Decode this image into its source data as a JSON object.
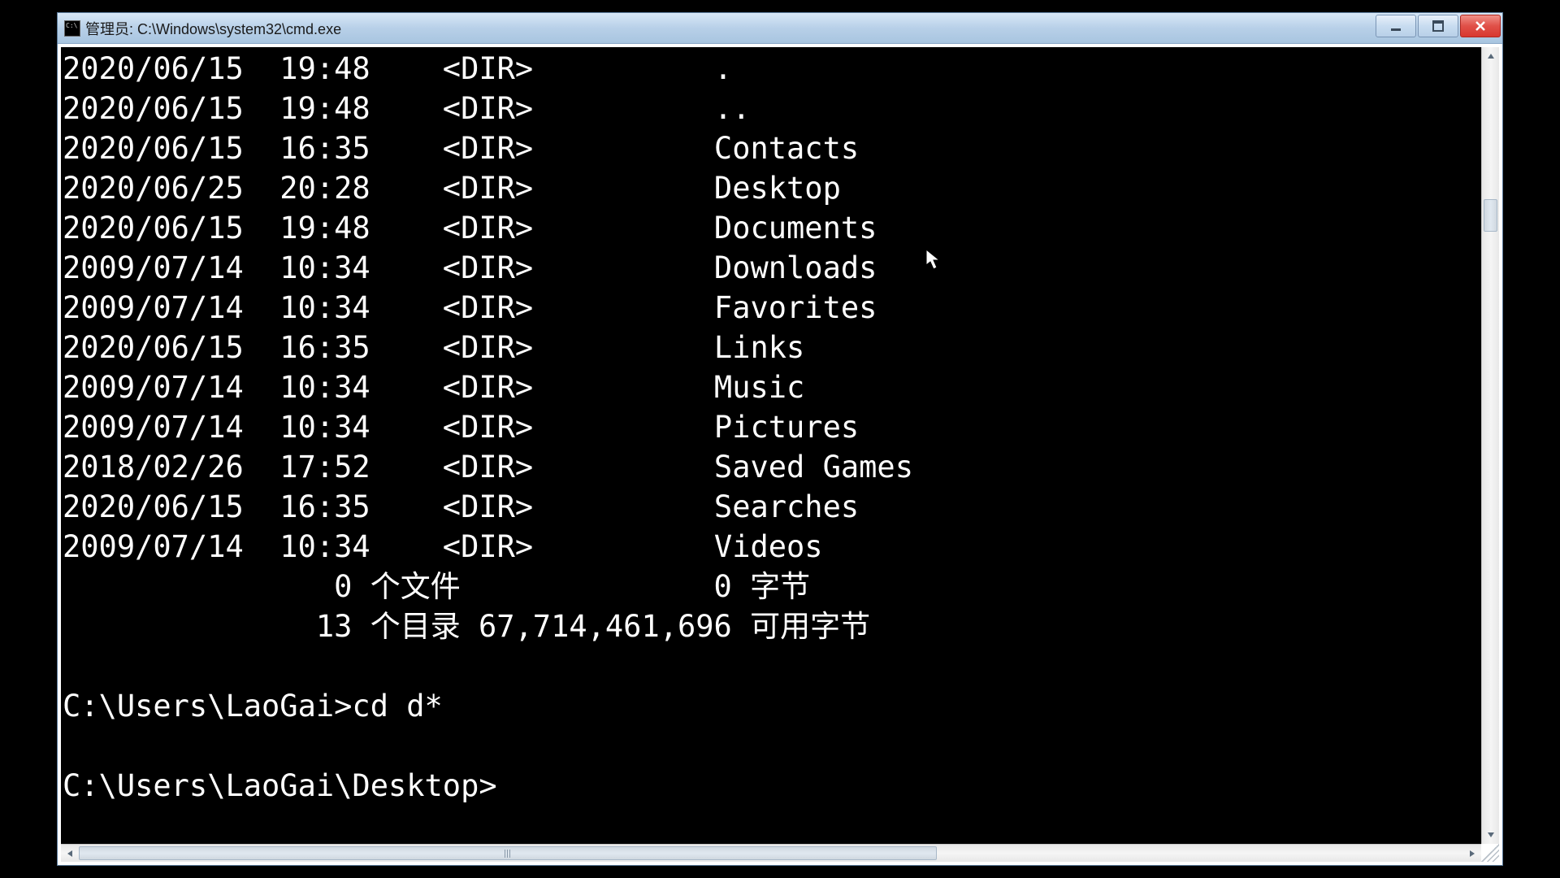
{
  "window": {
    "title": "管理员: C:\\Windows\\system32\\cmd.exe"
  },
  "dir_listing": [
    {
      "date": "2020/06/15",
      "time": "19:48",
      "type": "<DIR>",
      "name": "."
    },
    {
      "date": "2020/06/15",
      "time": "19:48",
      "type": "<DIR>",
      "name": ".."
    },
    {
      "date": "2020/06/15",
      "time": "16:35",
      "type": "<DIR>",
      "name": "Contacts"
    },
    {
      "date": "2020/06/25",
      "time": "20:28",
      "type": "<DIR>",
      "name": "Desktop"
    },
    {
      "date": "2020/06/15",
      "time": "19:48",
      "type": "<DIR>",
      "name": "Documents"
    },
    {
      "date": "2009/07/14",
      "time": "10:34",
      "type": "<DIR>",
      "name": "Downloads"
    },
    {
      "date": "2009/07/14",
      "time": "10:34",
      "type": "<DIR>",
      "name": "Favorites"
    },
    {
      "date": "2020/06/15",
      "time": "16:35",
      "type": "<DIR>",
      "name": "Links"
    },
    {
      "date": "2009/07/14",
      "time": "10:34",
      "type": "<DIR>",
      "name": "Music"
    },
    {
      "date": "2009/07/14",
      "time": "10:34",
      "type": "<DIR>",
      "name": "Pictures"
    },
    {
      "date": "2018/02/26",
      "time": "17:52",
      "type": "<DIR>",
      "name": "Saved Games"
    },
    {
      "date": "2020/06/15",
      "time": "16:35",
      "type": "<DIR>",
      "name": "Searches"
    },
    {
      "date": "2009/07/14",
      "time": "10:34",
      "type": "<DIR>",
      "name": "Videos"
    }
  ],
  "summary": {
    "files_line": "               0 个文件              0 字节",
    "dirs_line": "              13 个目录 67,714,461,696 可用字节"
  },
  "prompts": {
    "cmd1_prompt": "C:\\Users\\LaoGai>",
    "cmd1_input": "cd d*",
    "cmd2_prompt": "C:\\Users\\LaoGai\\Desktop>"
  }
}
